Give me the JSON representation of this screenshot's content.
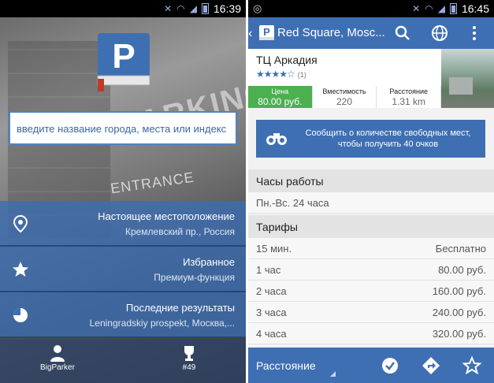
{
  "left_screen": {
    "status_time": "16:39",
    "search_placeholder": "введите название города, места или индекс",
    "background_words": {
      "parking": "PARKING",
      "entrance": "ENTRANCE"
    },
    "menu": [
      {
        "title": "Настоящее местоположение",
        "subtitle": "Кремлевский пр., Россия",
        "icon": "location-pin-icon"
      },
      {
        "title": "Избранное",
        "subtitle": "Премиум-функция",
        "icon": "star-icon"
      },
      {
        "title": "Последние результаты",
        "subtitle": "Leningradskiy prospekt, Москва,...",
        "icon": "history-pie-icon"
      }
    ],
    "bottom": {
      "user_label": "BigParker",
      "rank_label": "#49"
    }
  },
  "right_screen": {
    "status_time": "16:45",
    "actionbar_title": "Red Square, Mosc...",
    "place": {
      "name": "ТЦ Аркадия",
      "stars": "★★★★☆",
      "reviews": "(1)",
      "metrics": [
        {
          "label": "Цена",
          "value": "80.00 руб."
        },
        {
          "label": "Вместимость",
          "value": "220"
        },
        {
          "label": "Расстояние",
          "value": "1.31 km"
        }
      ]
    },
    "report_button": {
      "line1": "Сообщить о количестве свободных мест,",
      "line2": "чтобы получить 40 очков"
    },
    "hours": {
      "header": "Часы работы",
      "value": "Пн.-Вс. 24 часа"
    },
    "tariffs": {
      "header": "Тарифы",
      "rows": [
        {
          "duration": "15 мин.",
          "price": "Бесплатно"
        },
        {
          "duration": "1 час",
          "price": "80.00 руб."
        },
        {
          "duration": "2 часа",
          "price": "160.00 руб."
        },
        {
          "duration": "3 часа",
          "price": "240.00 руб."
        },
        {
          "duration": "4 часа",
          "price": "320.00 руб."
        }
      ]
    },
    "bottom": {
      "sort_label": "Расстояние"
    }
  },
  "colors": {
    "primary_blue": "#3f6fb3",
    "price_green": "#4caf50"
  }
}
